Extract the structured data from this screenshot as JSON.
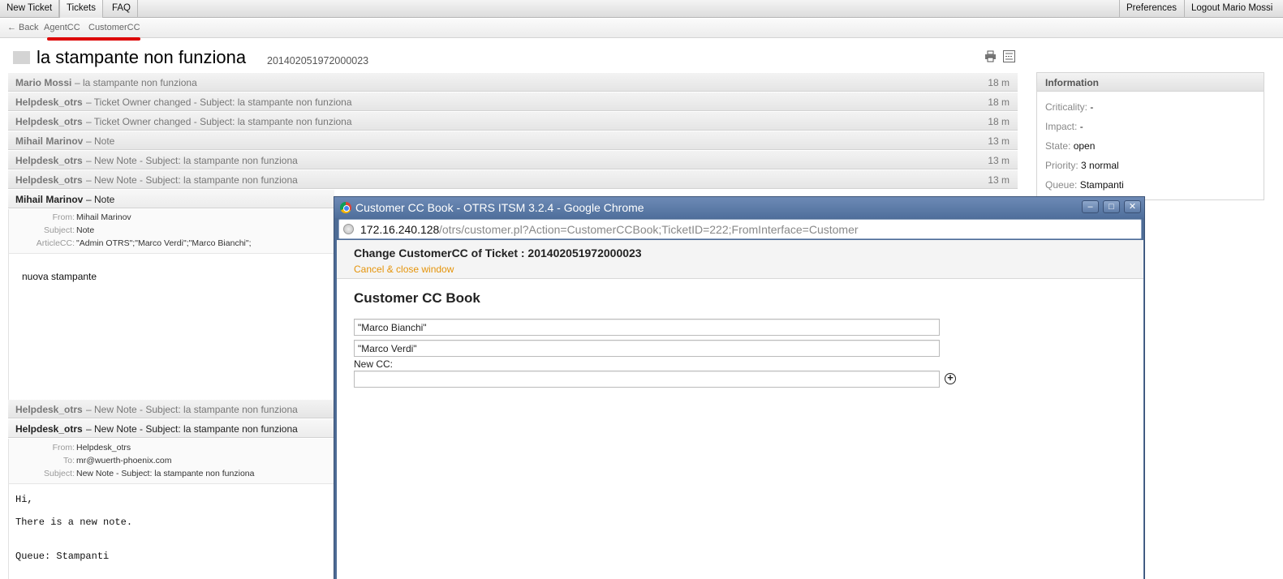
{
  "nav": {
    "new_ticket": "New Ticket",
    "tickets": "Tickets",
    "faq": "FAQ",
    "preferences": "Preferences",
    "logout": "Logout Mario Mossi"
  },
  "subnav": {
    "back": "← Back",
    "agentcc": "AgentCC",
    "customercc": "CustomerCC"
  },
  "ticket": {
    "title": "la stampante non funziona",
    "number": "201402051972000023"
  },
  "articles": [
    {
      "who": "Mario Mossi",
      "subject": "– la stampante non funziona",
      "time": "18 m"
    },
    {
      "who": "Helpdesk_otrs",
      "subject": "– Ticket Owner changed - Subject: la stampante non funziona",
      "time": "18 m"
    },
    {
      "who": "Helpdesk_otrs",
      "subject": "– Ticket Owner changed - Subject: la stampante non funziona",
      "time": "18 m"
    },
    {
      "who": "Mihail Marinov",
      "subject": "– Note",
      "time": "13 m"
    },
    {
      "who": "Helpdesk_otrs",
      "subject": "– New Note - Subject: la stampante non funziona",
      "time": "13 m"
    },
    {
      "who": "Helpdesk_otrs",
      "subject": "– New Note - Subject: la stampante non funziona",
      "time": "13 m"
    },
    {
      "who": "Mihail Marinov",
      "subject": "– Note",
      "time": ""
    },
    {
      "who": "Helpdesk_otrs",
      "subject": "– New Note - Subject: la stampante non funziona",
      "time": ""
    },
    {
      "who": "Helpdesk_otrs",
      "subject": "– New Note - Subject: la stampante non funziona",
      "time": ""
    }
  ],
  "article1": {
    "from_label": "From:",
    "from": "Mihail Marinov",
    "subject_label": "Subject:",
    "subject": "Note",
    "cc_label": "ArticleCC:",
    "cc": "\"Admin OTRS\";\"Marco Verdi\";\"Marco Bianchi\";",
    "body": "nuova stampante"
  },
  "article2": {
    "from_label": "From:",
    "from": "Helpdesk_otrs",
    "to_label": "To:",
    "to": "mr@wuerth-phoenix.com",
    "subject_label": "Subject:",
    "subject": "New Note - Subject: la stampante non funziona",
    "line1": "Hi,",
    "line2": "There is a new note.",
    "line3": "Queue: Stampanti"
  },
  "info": {
    "header": "Information",
    "criticality_label": "Criticality:",
    "criticality": "-",
    "impact_label": "Impact:",
    "impact": "-",
    "state_label": "State:",
    "state": "open",
    "priority_label": "Priority:",
    "priority": "3 normal",
    "queue_label": "Queue:",
    "queue": "Stampanti"
  },
  "popup": {
    "window_title": "Customer CC Book - OTRS ITSM 3.2.4 - Google Chrome",
    "url_host": "172.16.240.128",
    "url_path": "/otrs/customer.pl?Action=CustomerCCBook;TicketID=222;FromInterface=Customer",
    "heading": "Change CustomerCC of Ticket : 201402051972000023",
    "cancel": "Cancel & close window",
    "section_title": "Customer CC Book",
    "cc_entries": [
      "\"Marco Bianchi\"",
      "\"Marco Verdi\""
    ],
    "new_cc_label": "New CC:",
    "new_cc_value": ""
  },
  "icons": {
    "print": "print-icon",
    "split": "split-icon",
    "add": "add-icon",
    "chrome": "chrome-icon",
    "globe": "globe-icon"
  }
}
